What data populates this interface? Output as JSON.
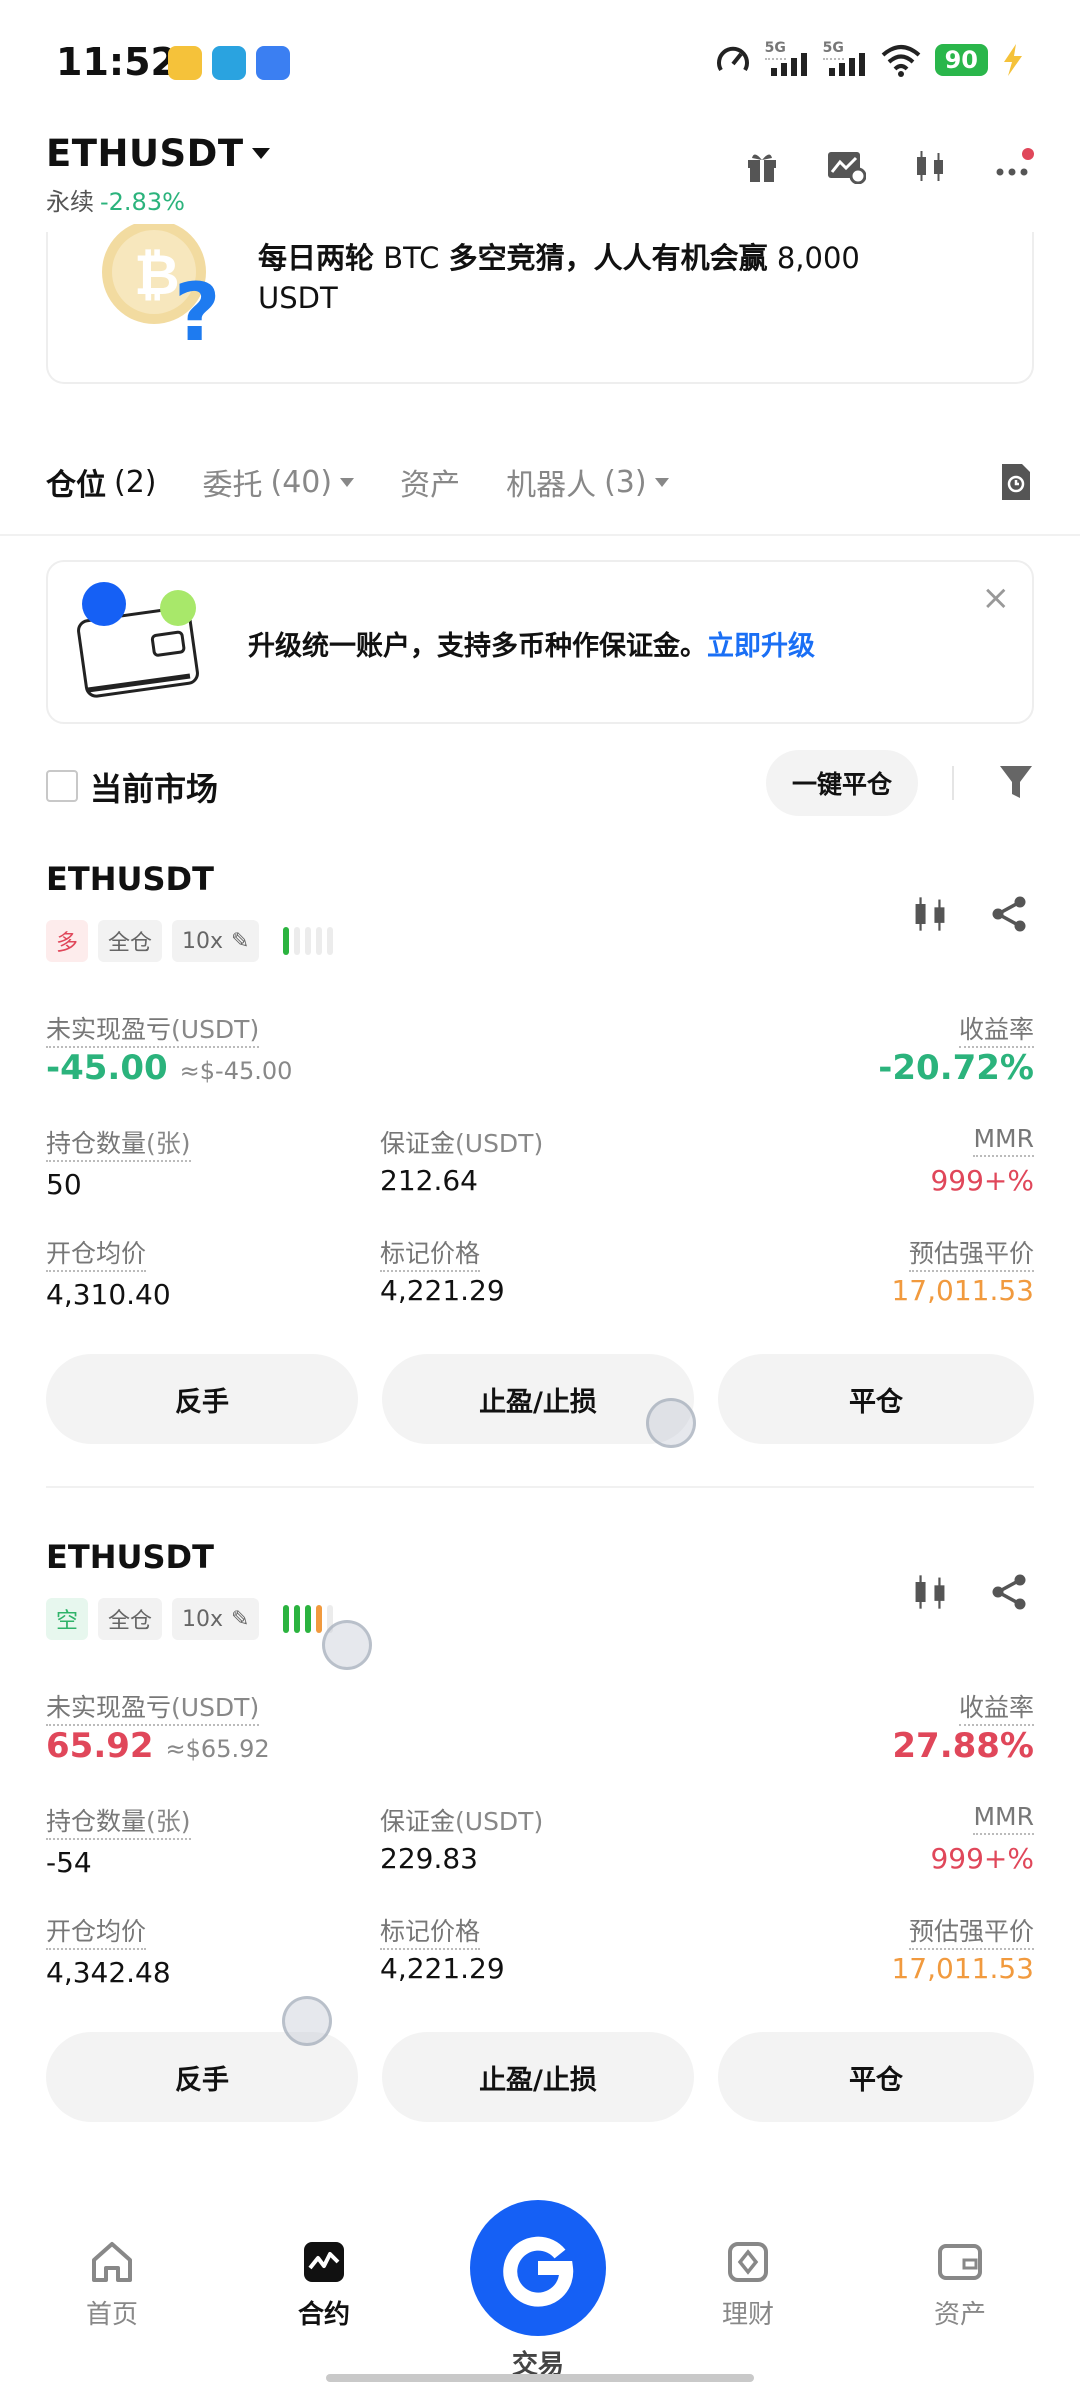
{
  "status_bar": {
    "time": "11:52",
    "signal_1": "5G",
    "signal_2": "5G",
    "battery": "90"
  },
  "header": {
    "symbol": "ETHUSDT",
    "contract_type": "永续",
    "change": "-2.83%"
  },
  "promo": {
    "text_bold_1": "每日两轮",
    "text_1": " BTC ",
    "text_bold_2": "多空竞猜，人人有机会赢",
    "text_2": " 8,000 USDT"
  },
  "tabs": [
    {
      "label": "仓位",
      "count": "(2)"
    },
    {
      "label": "委托",
      "count": "(40)"
    },
    {
      "label": "资产",
      "count": ""
    },
    {
      "label": "机器人",
      "count": "(3)"
    }
  ],
  "upgrade_banner": {
    "text": "升级统一账户，支持多币种作保证金。",
    "link": "立即升级"
  },
  "filter": {
    "current_market_label": "当前市场",
    "close_all_label": "一键平仓"
  },
  "labels": {
    "unrealized_pnl": "未实现盈亏",
    "usdt_unit": "(USDT)",
    "roe": "收益率",
    "quantity": "持仓数量",
    "quantity_unit": "(张)",
    "margin": "保证金",
    "mmr": "MMR",
    "entry_price": "开仓均价",
    "mark_price": "标记价格",
    "liq_price": "预估强平价",
    "cross": "全仓",
    "reverse": "反手",
    "tpsl": "止盈/止损",
    "close": "平仓"
  },
  "positions": [
    {
      "symbol": "ETHUSDT",
      "side": "多",
      "leverage": "10x",
      "unrealized_pnl": "-45.00",
      "pnl_usd": "≈$-45.00",
      "roe": "-20.72%",
      "quantity": "50",
      "margin": "212.64",
      "mmr": "999+%",
      "entry_price": "4,310.40",
      "mark_price": "4,221.29",
      "liq_price": "17,011.53",
      "risk_level": 1
    },
    {
      "symbol": "ETHUSDT",
      "side": "空",
      "leverage": "10x",
      "unrealized_pnl": "65.92",
      "pnl_usd": "≈$65.92",
      "roe": "27.88%",
      "quantity": "-54",
      "margin": "229.83",
      "mmr": "999+%",
      "entry_price": "4,342.48",
      "mark_price": "4,221.29",
      "liq_price": "17,011.53",
      "risk_level": 4
    }
  ],
  "bottom_nav": [
    {
      "label": "首页",
      "icon": "home-icon"
    },
    {
      "label": "合约",
      "icon": "futures-icon"
    },
    {
      "label": "交易",
      "icon": "trade-icon"
    },
    {
      "label": "理财",
      "icon": "earn-icon"
    },
    {
      "label": "资产",
      "icon": "wallet-icon"
    }
  ]
}
